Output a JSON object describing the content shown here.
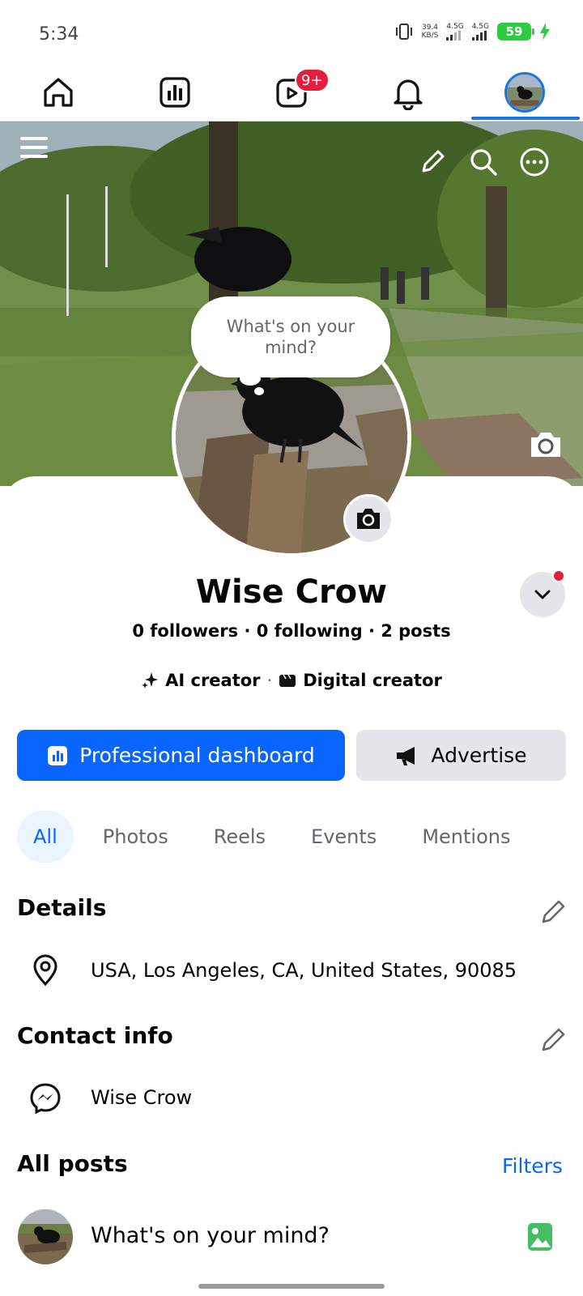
{
  "status_bar": {
    "time": "5:34",
    "net_speed_value": "39.4",
    "net_speed_unit": "KB/S",
    "signal1_label": "4.5G",
    "signal2_label": "4.5G",
    "battery_level": "59"
  },
  "nav": {
    "reels_badge": "9+",
    "items": [
      "home-icon",
      "dashboard-icon",
      "reels-icon",
      "bell-icon",
      "profile-avatar"
    ],
    "active": "profile-avatar",
    "accent_color": "#1b74e4"
  },
  "cover": {
    "actions": [
      "menu-icon",
      "pencil-icon",
      "search-icon",
      "more-icon",
      "camera-icon"
    ]
  },
  "bubble": {
    "text": "What's on your mind?"
  },
  "profile": {
    "name": "Wise Crow",
    "stats": "0 followers · 0 following · 2 posts",
    "category1": "AI creator",
    "category_sep": "·",
    "category2": "Digital creator"
  },
  "buttons": {
    "primary_label": "Professional dashboard",
    "secondary_label": "Advertise"
  },
  "tabs": [
    "All",
    "Photos",
    "Reels",
    "Events",
    "Mentions"
  ],
  "details": {
    "title": "Details",
    "location": "USA, Los Angeles, CA, United States, 90085"
  },
  "contact": {
    "title": "Contact info",
    "messenger": "Wise Crow"
  },
  "posts": {
    "title": "All posts",
    "filters_label": "Filters",
    "composer_placeholder": "What's on your mind?"
  },
  "colors": {
    "brand_blue": "#0866ff",
    "badge_red": "#e41e3f",
    "photo_green": "#45bd62"
  }
}
